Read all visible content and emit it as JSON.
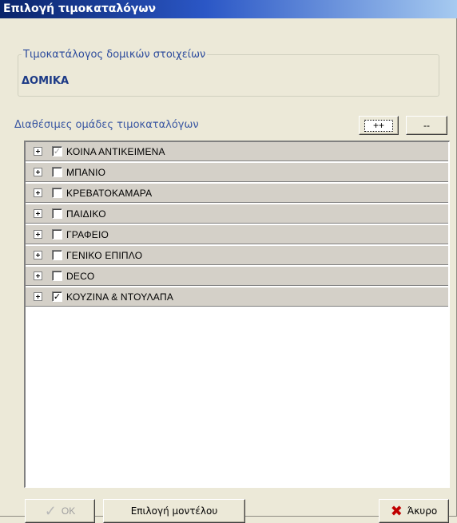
{
  "window": {
    "title": "Επιλογή τιμοκαταλόγων"
  },
  "group": {
    "legend": "Τιμοκατάλογος δομικών στοιχείων",
    "value": "ΔΟΜΙΚΑ"
  },
  "available_label": "Διαθέσιμες ομάδες τιμοκαταλόγων",
  "buttons": {
    "expand_all": "++",
    "collapse_all": "--",
    "ok": "ΟΚ",
    "select_model": "Επιλογή μοντέλου",
    "cancel": "Άκυρο"
  },
  "groups_list": [
    {
      "label": "ΚΟΙΝΑ ΑΝΤΙΚΕΙΜΕΝΑ",
      "checked": true,
      "disabled": true
    },
    {
      "label": "ΜΠΑΝΙΟ",
      "checked": false,
      "disabled": false
    },
    {
      "label": "ΚΡΕΒΑΤΟΚΑΜΑΡΑ",
      "checked": false,
      "disabled": false
    },
    {
      "label": "ΠΑΙΔΙΚΟ",
      "checked": false,
      "disabled": false
    },
    {
      "label": "ΓΡΑΦΕΙΟ",
      "checked": false,
      "disabled": false
    },
    {
      "label": "ΓΕΝΙΚΟ ΕΠΙΠΛΟ",
      "checked": false,
      "disabled": false
    },
    {
      "label": "DECO",
      "checked": false,
      "disabled": false
    },
    {
      "label": "ΚΟΥΖΙΝΑ & ΝΤΟΥΛΑΠΑ",
      "checked": true,
      "disabled": false
    }
  ],
  "icons": {
    "expand": "plus-box-icon",
    "ok": "checkmark-icon",
    "cancel": "red-x-icon"
  }
}
